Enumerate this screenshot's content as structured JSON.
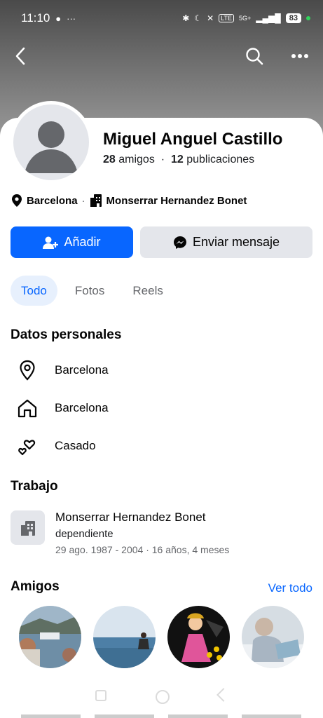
{
  "status": {
    "time": "11:10",
    "battery": "83",
    "network": "5G+"
  },
  "profile": {
    "name": "Miguel Anguel Castillo",
    "friends_count": "28",
    "friends_label": "amigos",
    "posts_count": "12",
    "posts_label": "publicaciones",
    "location": "Barcelona",
    "workplace": "Monserrar Hernandez Bonet"
  },
  "actions": {
    "add_label": "Añadir",
    "message_label": "Enviar mensaje"
  },
  "tabs": [
    {
      "label": "Todo",
      "active": true
    },
    {
      "label": "Fotos",
      "active": false
    },
    {
      "label": "Reels",
      "active": false
    }
  ],
  "personal": {
    "title": "Datos personales",
    "items": [
      {
        "icon": "location-pin-icon",
        "text": "Barcelona"
      },
      {
        "icon": "home-icon",
        "text": "Barcelona"
      },
      {
        "icon": "hearts-icon",
        "text": "Casado"
      }
    ]
  },
  "work": {
    "title": "Trabajo",
    "company": "Monserrar Hernandez Bonet",
    "role": "dependiente",
    "dates": "29 ago. 1987 - 2004 · 16 años, 4 meses"
  },
  "friends_section": {
    "title": "Amigos",
    "see_all": "Ver todo"
  },
  "colors": {
    "accent": "#0866ff",
    "secondary_button": "#e4e6eb",
    "active_tab_bg": "#e7f0fd"
  }
}
